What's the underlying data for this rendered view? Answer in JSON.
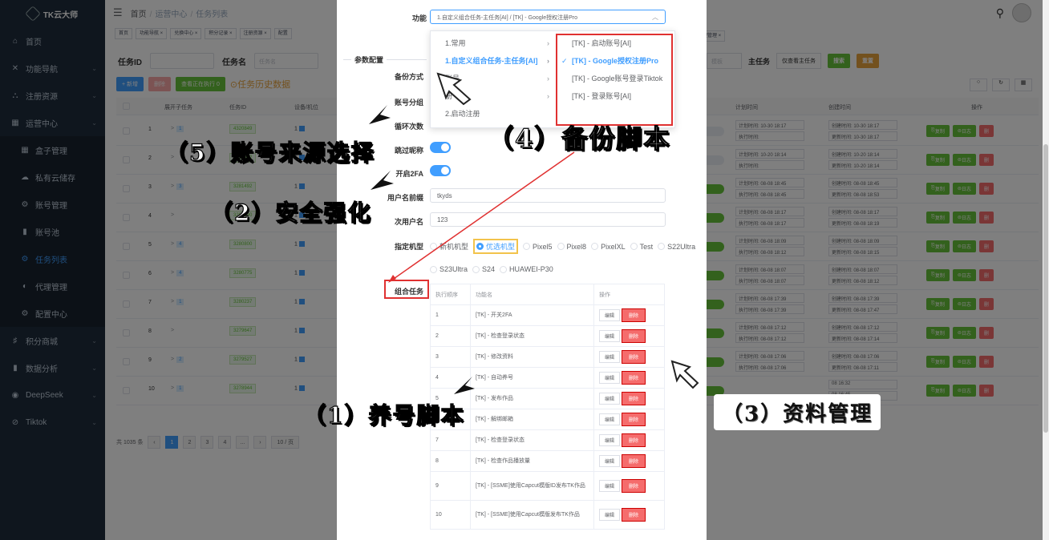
{
  "app": {
    "logo": "TK云大师"
  },
  "sidebar": [
    {
      "icon": "⌂",
      "label": "首页"
    },
    {
      "icon": "✕",
      "label": "功能导航",
      "arrow": true
    },
    {
      "icon": "⛬",
      "label": "注册资源",
      "arrow": true
    },
    {
      "icon": "▦",
      "label": "运营中心",
      "arrow": true
    },
    {
      "icon": "▦",
      "label": "盒子管理",
      "sub": true
    },
    {
      "icon": "☁",
      "label": "私有云储存",
      "sub": true
    },
    {
      "icon": "⚙",
      "label": "账号管理",
      "sub": true
    },
    {
      "icon": "▮",
      "label": "账号池",
      "sub": true
    },
    {
      "icon": "⚙",
      "label": "任务列表",
      "sub": true,
      "active": true
    },
    {
      "icon": "◐",
      "label": "代理管理",
      "sub": true
    },
    {
      "icon": "⚙",
      "label": "配置中心",
      "sub": true
    },
    {
      "icon": "♯",
      "label": "积分商城",
      "arrow": true
    },
    {
      "icon": "▮",
      "label": "数据分析",
      "arrow": true
    },
    {
      "icon": "◉",
      "label": "DeepSeek",
      "arrow": true
    },
    {
      "icon": "⊘",
      "label": "Tiktok",
      "arrow": true
    }
  ],
  "breadcrumb": {
    "home": "首页",
    "mid": "运营中心",
    "current": "任务列表"
  },
  "tags": [
    "首页 ",
    "功能导航 ×",
    "兑换中心 ×",
    "积分记录 ×",
    "注册资源 ×",
    "配置"
  ],
  "filter": {
    "task_id_label": "任务ID",
    "task_name_label": "任务名",
    "task_name_ph": "任务名",
    "main_task_label": "主任务",
    "main_task_value": "仅查看主任务",
    "search": "搜索",
    "reset": "重置",
    "board_ph": "模板",
    "tag_right": "理管理 ×"
  },
  "buttons": {
    "add": "+ 新增",
    "delete": "删除",
    "view_running": "查看正在执行 0",
    "history": "任务历史数据"
  },
  "table": {
    "headers": {
      "expand": "展开子任务",
      "id": "任务ID",
      "device": "设备/机位",
      "plan": "计划时间",
      "create": "创建时间",
      "ops": "操作"
    },
    "rows": [
      {
        "idx": "1",
        "exp": "1",
        "rid": "4320849",
        "dev": "1",
        "t1": "计划时间: 10-30 18:17",
        "t2": "执行时间:",
        "c1": "创建时间: 10-30 18:17",
        "c2": "更新时间: 10-30 18:17",
        "pill": false
      },
      {
        "idx": "2",
        "exp": "",
        "rid": "4320892",
        "dev": "1",
        "t1": "计划时间: 10-20 18:14",
        "t2": "执行时间:",
        "c1": "创建时间: 10-20 18:14",
        "c2": "更新时间: 10-20 18:14",
        "pill": false
      },
      {
        "idx": "3",
        "exp": "3",
        "rid": "3281492",
        "dev": "1",
        "t1": "计划时间: 08-08 18:45",
        "t2": "执行时间: 08-08 18:45",
        "c1": "创建时间: 08-08 18:45",
        "c2": "更新时间: 08-08 18:53",
        "pill": true
      },
      {
        "idx": "4",
        "exp": "",
        "rid": "3280890",
        "dev": "1",
        "t1": "计划时间: 08-08 18:17",
        "t2": "执行时间: 08-08 18:17",
        "c1": "创建时间: 08-08 18:17",
        "c2": "更新时间: 08-08 18:19",
        "pill": true
      },
      {
        "idx": "5",
        "exp": "4",
        "rid": "3280800",
        "dev": "1",
        "t1": "计划时间: 08-08 18:09",
        "t2": "执行时间: 08-08 18:12",
        "c1": "创建时间: 08-08 18:09",
        "c2": "更新时间: 08-08 18:15",
        "pill": true
      },
      {
        "idx": "6",
        "exp": "4",
        "rid": "3280775",
        "dev": "1",
        "t1": "计划时间: 08-08 18:07",
        "t2": "执行时间: 08-08 18:07",
        "c1": "创建时间: 08-08 18:07",
        "c2": "更新时间: 08-08 18:12",
        "pill": true
      },
      {
        "idx": "7",
        "exp": "1",
        "rid": "3280237",
        "dev": "1",
        "t1": "计划时间: 08-08 17:39",
        "t2": "执行时间: 08-08 17:39",
        "c1": "创建时间: 08-08 17:39",
        "c2": "更新时间: 08-08 17:47",
        "pill": true
      },
      {
        "idx": "8",
        "exp": "",
        "rid": "3279647",
        "dev": "1",
        "t1": "计划时间: 08-08 17:12",
        "t2": "执行时间: 08-08 17:12",
        "c1": "创建时间: 08-08 17:12",
        "c2": "更新时间: 08-08 17:14",
        "pill": true
      },
      {
        "idx": "9",
        "exp": "2",
        "rid": "3279527",
        "dev": "1",
        "t1": "计划时间: 08-08 17:06",
        "t2": "执行时间: 08-08 17:06",
        "c1": "创建时间: 08-08 17:06",
        "c2": "更新时间: 08-08 17:11",
        "pill": true
      },
      {
        "idx": "10",
        "exp": "1",
        "rid": "3278944",
        "dev": "1",
        "t1": "",
        "t2": "",
        "c1": "08 16:32",
        "c2": "08 16:45",
        "pill": true
      }
    ],
    "ops": {
      "copy": "复制",
      "log": "日志",
      "del": "删"
    }
  },
  "pager": {
    "total": "共 1035 条",
    "pages": [
      "1",
      "2",
      "3",
      "4",
      "..."
    ],
    "size": "10 / 页"
  },
  "modal": {
    "func_label": "功能",
    "func_value": "1.自定义组合任务-主任务[AI] / [TK] - Google授权注册Pro",
    "param_title": "参数配置",
    "backup_label": "备份方式",
    "group_label": "账号分组",
    "loop_label": "循环次数",
    "skip_label": "跳过昵称",
    "twofa_label": "开启2FA",
    "prefix_label": "用户名前缀",
    "prefix_value": "tkyds",
    "second_label": "次用户名",
    "second_value": "123",
    "model_label": "指定机型",
    "models": [
      "新机机型",
      "优选机型",
      "Pixel5",
      "Pixel8",
      "PixelXL",
      "Test",
      "S22Ultra",
      "S23Ultra",
      "S24",
      "HUAWEI-P30"
    ],
    "combo_label": "组合任务",
    "combo_headers": {
      "order": "执行顺序",
      "name": "功能名",
      "ops": "操作"
    },
    "combo_rows": [
      {
        "n": "1",
        "name": "[TK] - 开关2FA"
      },
      {
        "n": "2",
        "name": "[TK] - 检查登录状态"
      },
      {
        "n": "3",
        "name": "[TK] - 修改资料"
      },
      {
        "n": "4",
        "name": "[TK] - 自动养号"
      },
      {
        "n": "5",
        "name": "[TK] - 发布作品"
      },
      {
        "n": "6",
        "name": "[TK] - 解绑邮箱"
      },
      {
        "n": "7",
        "name": "[TK] - 检查登录状态"
      },
      {
        "n": "8",
        "name": "[TK] - 检查作品播放量"
      },
      {
        "n": "9",
        "name": "[TK] - [SSME]使用Capcut模版ID发布TK作品"
      },
      {
        "n": "10",
        "name": "[TK] - [SSME]使用Capcut模版发布TK作品"
      }
    ],
    "edit": "编辑",
    "delete": "删除"
  },
  "dropdown": {
    "col1": [
      {
        "label": "1.常用",
        "arrow": true
      },
      {
        "label": "1.自定义组合任务-主任务[AI]",
        "arrow": true,
        "sel": true
      },
      {
        "label": "账号",
        "arrow": true
      },
      {
        "label": "册",
        "arrow": true
      },
      {
        "label": "2.启动注册",
        "arrow": false
      }
    ],
    "col2": [
      {
        "label": "[TK] - 启动账号[AI]"
      },
      {
        "label": "[TK] - Google授权注册Pro",
        "sel": true
      },
      {
        "label": "[TK] - Google账号登录Tiktok"
      },
      {
        "label": "[TK] - 登录账号[AI]"
      }
    ]
  },
  "annotations": {
    "a1": "（1）养号脚本",
    "a2": "（2）安全强化",
    "a3": "（3）资料管理",
    "a4": "（4）备份脚本",
    "a5": "（5）账号来源选择"
  },
  "colors": {
    "primary": "#409eff",
    "danger": "#f56c6c",
    "success": "#67c23a",
    "warning": "#e6a23c",
    "annotation_red": "#e03131"
  }
}
